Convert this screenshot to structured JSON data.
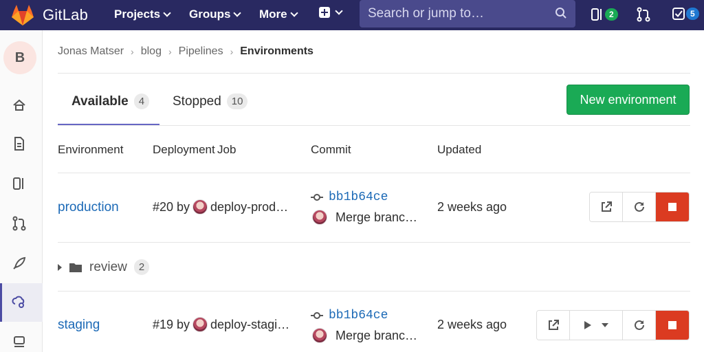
{
  "navbar": {
    "brand": "GitLab",
    "projects": "Projects",
    "groups": "Groups",
    "more": "More",
    "search_placeholder": "Search or jump to…",
    "issues_count": "2",
    "todos_count": "5"
  },
  "sidebar": {
    "avatar_letter": "B"
  },
  "breadcrumb": {
    "items": [
      "Jonas Matser",
      "blog",
      "Pipelines"
    ],
    "current": "Environments"
  },
  "tabs": {
    "available_label": "Available",
    "available_count": "4",
    "stopped_label": "Stopped",
    "stopped_count": "10"
  },
  "new_env_button": "New environment",
  "table": {
    "headers": [
      "Environment",
      "Deployment",
      "Job",
      "Commit",
      "Updated"
    ],
    "rows": [
      {
        "name": "production",
        "deployment": "#20 by",
        "job": "deploy-prod…",
        "sha": "bb1b64ce",
        "commit_title": "Merge branc…",
        "updated": "2 weeks ago"
      },
      {
        "folder": "review",
        "count": "2"
      },
      {
        "name": "staging",
        "deployment": "#19 by",
        "job": "deploy-stagi…",
        "sha": "bb1b64ce",
        "commit_title": "Merge branc…",
        "updated": "2 weeks ago"
      }
    ]
  },
  "colors": {
    "navbar": "#292961",
    "accent": "#6666c4",
    "link": "#1b69b6",
    "success": "#1aaa55",
    "danger": "#db3b21"
  }
}
